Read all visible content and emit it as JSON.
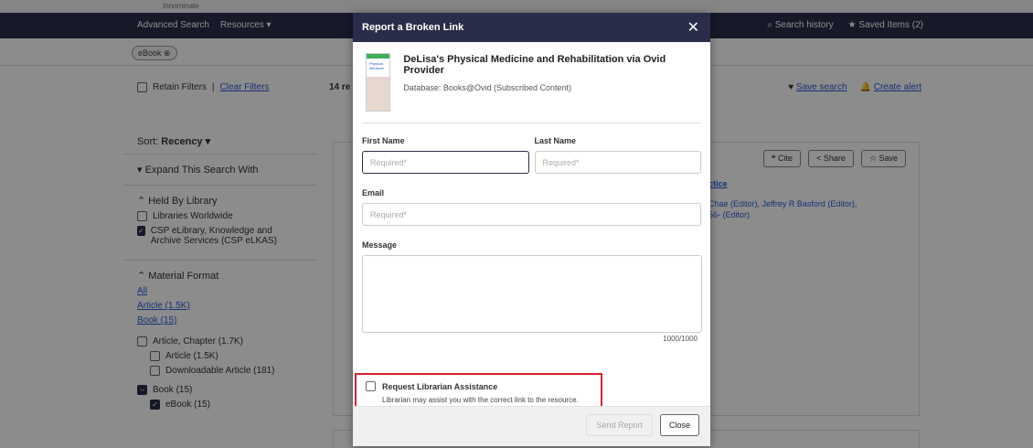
{
  "topstrip": {
    "text": "Innominate"
  },
  "nav": {
    "advanced_search": "Advanced Search",
    "resources": "Resources ▾",
    "search_history": "Search history",
    "saved_items": "Saved Items (2)"
  },
  "chip": {
    "label": "eBook"
  },
  "filters": {
    "retain": "Retain Filters",
    "clear": "Clear Filters",
    "results": "14 re",
    "save_search": "Save search",
    "create_alert": "Create alert"
  },
  "sort": {
    "label": "Sort:",
    "value": "Recency ▾"
  },
  "sidebar": {
    "expand": "Expand This Search With",
    "held_by": "Held By Library",
    "libraries_worldwide": "Libraries Worldwide",
    "csp": "CSP eLibrary, Knowledge and Archive Services (CSP eLKAS)",
    "material_format": "Material Format",
    "all": "All",
    "article": "Article (1.5K)",
    "book": "Book (15)",
    "article_chapter": "Article, Chapter (1.7K)",
    "article_sub": "Article (1.5K)",
    "downloadable": "Downloadable Article (181)",
    "book_sub": "Book (15)",
    "ebook": "eBook (15)"
  },
  "card": {
    "cite": "Cite",
    "share": "Share",
    "save": "Save",
    "snippet1": "ctice",
    "snippet2": "Chae (Editor), Jeffrey R Basford (Editor),",
    "snippet3": "56- (Editor)"
  },
  "modal": {
    "title": "Report a Broken Link",
    "close_symbol": "✕",
    "book_title": "DeLisa's Physical Medicine and Rehabilitation via Ovid Provider",
    "database": "Database: Books@Ovid (Subscribed Content)",
    "first_name_label": "First Name",
    "last_name_label": "Last Name",
    "email_label": "Email",
    "message_label": "Message",
    "placeholder_required": "Required*",
    "counter": "1000/1000",
    "assist_title": "Request Librarian Assistance",
    "assist_desc": "Librarian may assist you with the correct link to the resource.",
    "send_button": "Send Report",
    "close_button": "Close"
  }
}
